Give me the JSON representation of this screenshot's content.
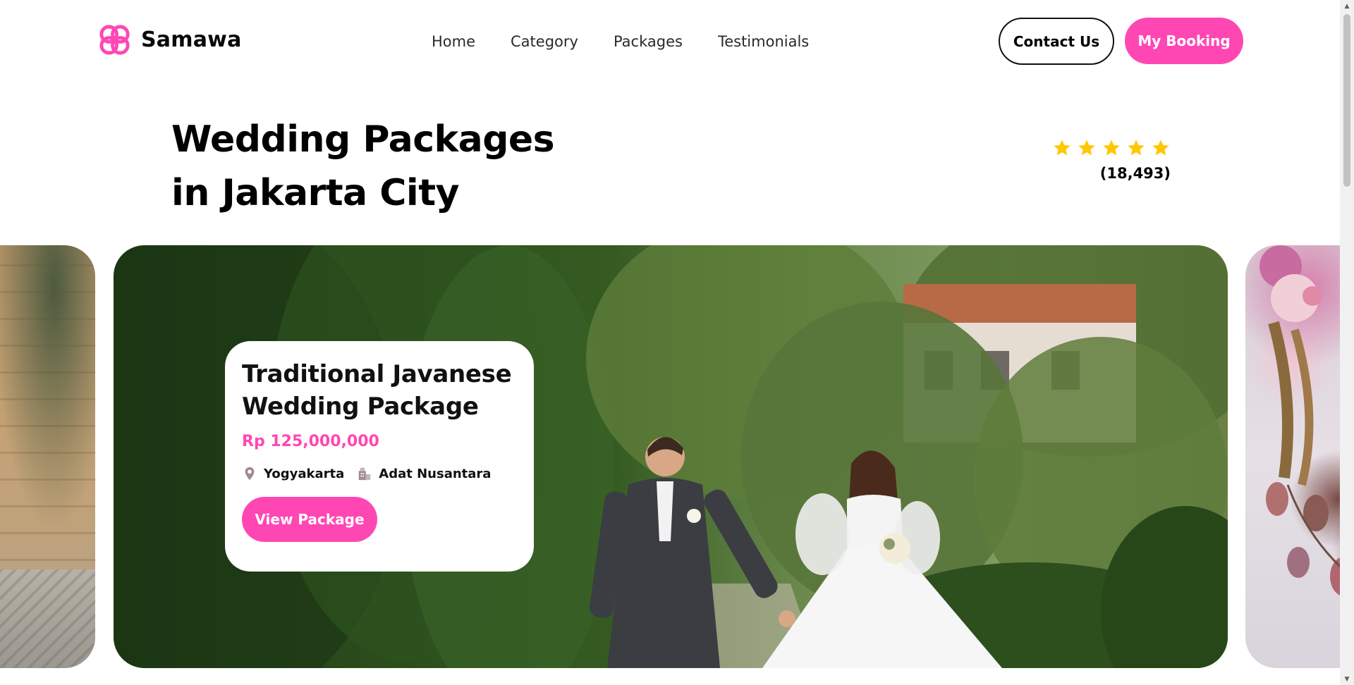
{
  "brand": {
    "name": "Samawa",
    "color": "#ff47b4"
  },
  "nav": {
    "items": [
      {
        "label": "Home"
      },
      {
        "label": "Category"
      },
      {
        "label": "Packages"
      },
      {
        "label": "Testimonials"
      }
    ]
  },
  "header_actions": {
    "contact_label": "Contact Us",
    "booking_label": "My Booking"
  },
  "hero": {
    "title_line1": "Wedding Packages",
    "title_line2": "in Jakarta City"
  },
  "rating": {
    "stars": 5,
    "star_color": "#ffc700",
    "review_count": "(18,493)"
  },
  "carousel": {
    "featured": {
      "title_line1": "Traditional Javanese",
      "title_line2": "Wedding Package",
      "price": "Rp 125,000,000",
      "location": "Yogyakarta",
      "organizer": "Adat Nusantara",
      "cta_label": "View Package",
      "location_icon": "map-pin-icon",
      "organizer_icon": "building-icon"
    }
  },
  "scrollbar": {
    "up_glyph": "▲",
    "down_glyph": "▼"
  }
}
